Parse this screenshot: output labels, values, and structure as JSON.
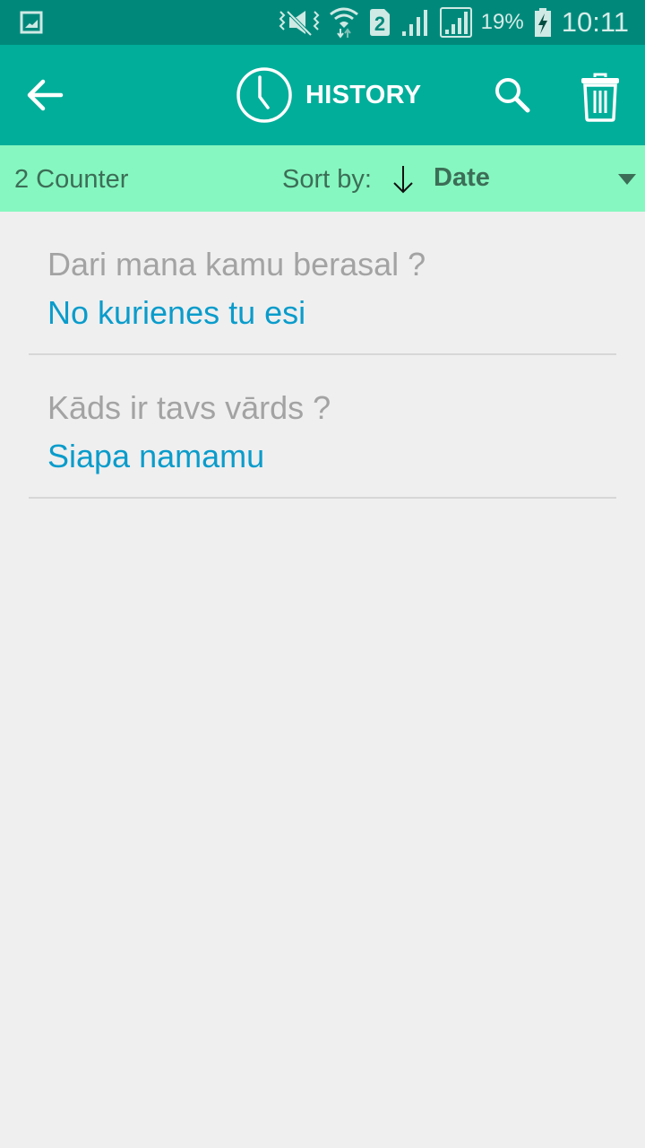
{
  "status_bar": {
    "battery_percent": "19%",
    "time": "10:11",
    "sim_slot": "2",
    "icons": [
      "gallery-notification-icon",
      "vibrate-mute-icon",
      "wifi-icon",
      "sim-2-icon",
      "signal-icon",
      "signal-icon-2",
      "battery-charging-icon"
    ]
  },
  "app_bar": {
    "title": "HISTORY",
    "icons": [
      "back-arrow-icon",
      "clock-icon",
      "search-icon",
      "trash-icon"
    ]
  },
  "sort_bar": {
    "counter": "2 Counter",
    "sort_label": "Sort by:",
    "sort_direction": "descending",
    "sort_value": "Date"
  },
  "history": [
    {
      "source": "Dari mana kamu berasal ?",
      "translation": "No kurienes tu esi"
    },
    {
      "source": "Kāds ir tavs vārds ?",
      "translation": "Siapa namamu"
    }
  ],
  "colors": {
    "status_bar": "#00897b",
    "app_bar": "#00ae9a",
    "sort_bar": "#86f7c0",
    "translation_text": "#0a9ccb",
    "source_text": "#a3a3a3"
  }
}
